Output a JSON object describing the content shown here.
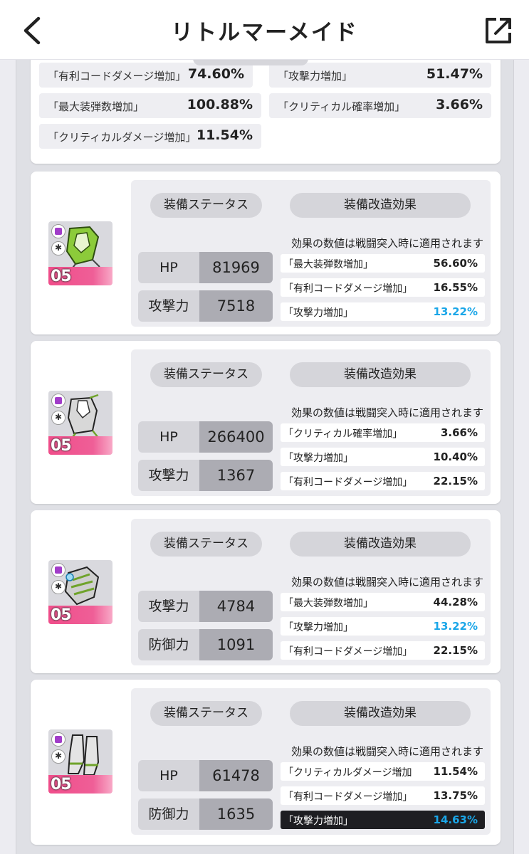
{
  "header": {
    "title": "リトルマーメイド"
  },
  "summary": {
    "stats": [
      {
        "label": "「有利コードダメージ増加」",
        "value": "74.60%"
      },
      {
        "label": "「攻撃力増加」",
        "value": "51.47%"
      },
      {
        "label": "「最大装弾数増加」",
        "value": "100.88%"
      },
      {
        "label": "「クリティカル確率増加」",
        "value": "3.66%"
      },
      {
        "label": "「クリティカルダメージ増加」",
        "value": "11.54%"
      }
    ]
  },
  "equipment": [
    {
      "level": "05",
      "status_header": "装備ステータス",
      "mod_header": "装備改造効果",
      "note": "効果の数値は戦闘突入時に適用されます",
      "stats": [
        {
          "name": "HP",
          "value": "81969"
        },
        {
          "name": "攻撃力",
          "value": "7518"
        }
      ],
      "effects": [
        {
          "label": "「最大装弾数増加」",
          "value": "56.60%"
        },
        {
          "label": "「有利コードダメージ増加」",
          "value": "16.55%"
        },
        {
          "label": "「攻撃力増加」",
          "value": "13.22%"
        }
      ]
    },
    {
      "level": "05",
      "status_header": "装備ステータス",
      "mod_header": "装備改造効果",
      "note": "効果の数値は戦闘突入時に適用されます",
      "stats": [
        {
          "name": "HP",
          "value": "266400"
        },
        {
          "name": "攻撃力",
          "value": "1367"
        }
      ],
      "effects": [
        {
          "label": "「クリティカル確率増加」",
          "value": "3.66%"
        },
        {
          "label": "「攻撃力増加」",
          "value": "10.40%"
        },
        {
          "label": "「有利コードダメージ増加」",
          "value": "22.15%"
        }
      ]
    },
    {
      "level": "05",
      "status_header": "装備ステータス",
      "mod_header": "装備改造効果",
      "note": "効果の数値は戦闘突入時に適用されます",
      "stats": [
        {
          "name": "攻撃力",
          "value": "4784"
        },
        {
          "name": "防御力",
          "value": "1091"
        }
      ],
      "effects": [
        {
          "label": "「最大装弾数増加」",
          "value": "44.28%"
        },
        {
          "label": "「攻撃力増加」",
          "value": "13.22%"
        },
        {
          "label": "「有利コードダメージ増加」",
          "value": "22.15%"
        }
      ]
    },
    {
      "level": "05",
      "status_header": "装備ステータス",
      "mod_header": "装備改造効果",
      "note": "効果の数値は戦闘突入時に適用されます",
      "stats": [
        {
          "name": "HP",
          "value": "61478"
        },
        {
          "name": "防御力",
          "value": "1635"
        }
      ],
      "effects": [
        {
          "label": "「クリティカルダメージ増加」",
          "value": "11.54%"
        },
        {
          "label": "「有利コードダメージ増加」",
          "value": "13.75%"
        },
        {
          "label": "「攻撃力増加」",
          "value": "14.63%"
        }
      ]
    }
  ],
  "colors": {
    "accent_blue": "#1aa6e8",
    "level_pink": "#f04d8a",
    "highlight_row": "#1e1e22"
  }
}
